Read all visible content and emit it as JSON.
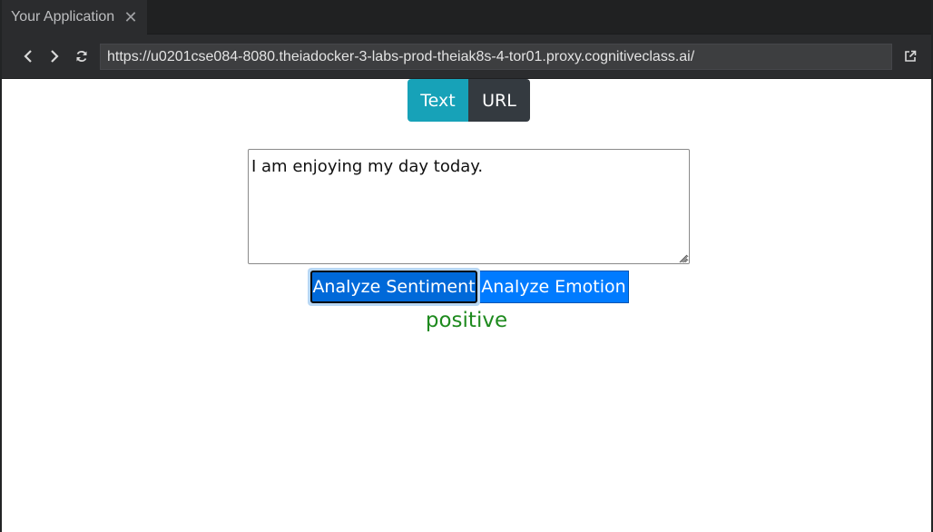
{
  "tab": {
    "title": "Your Application",
    "close_icon": "close-icon"
  },
  "toolbar": {
    "back_icon": "chevron-left-icon",
    "forward_icon": "chevron-right-icon",
    "reload_icon": "reload-icon",
    "url": "https://u0201cse084-8080.theiadocker-3-labs-prod-theiak8s-4-tor01.proxy.cognitiveclass.ai/",
    "open_external_icon": "external-link-icon"
  },
  "modes": {
    "text_label": "Text",
    "url_label": "URL",
    "active": "Text"
  },
  "input": {
    "value": "I am enjoying my day today."
  },
  "actions": {
    "sentiment_label": "Analyze Sentiment",
    "emotion_label": "Analyze Emotion"
  },
  "result": {
    "text": "positive"
  },
  "colors": {
    "text_mode": "#17a2b8",
    "url_mode": "#343a40",
    "primary": "#007bff",
    "result_green": "#1e8a1e"
  }
}
